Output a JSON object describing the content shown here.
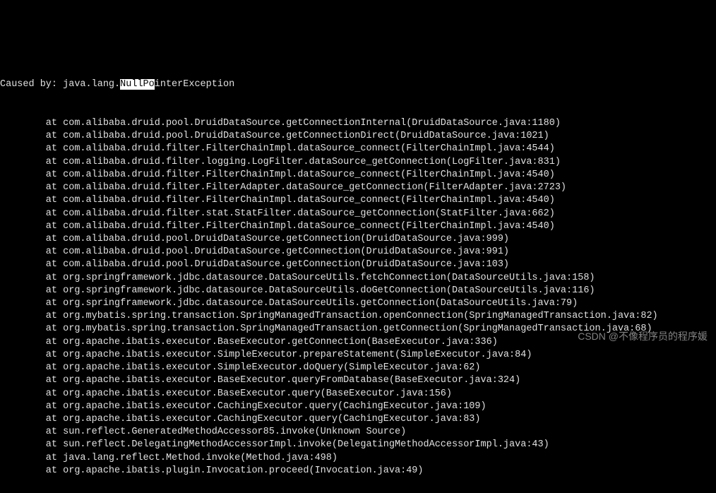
{
  "exception": {
    "prefix": "Caused by: java.lang.",
    "highlighted": "NullPo",
    "suffix": "interException"
  },
  "stack": [
    "        at com.alibaba.druid.pool.DruidDataSource.getConnectionInternal(DruidDataSource.java:1180)",
    "        at com.alibaba.druid.pool.DruidDataSource.getConnectionDirect(DruidDataSource.java:1021)",
    "        at com.alibaba.druid.filter.FilterChainImpl.dataSource_connect(FilterChainImpl.java:4544)",
    "        at com.alibaba.druid.filter.logging.LogFilter.dataSource_getConnection(LogFilter.java:831)",
    "        at com.alibaba.druid.filter.FilterChainImpl.dataSource_connect(FilterChainImpl.java:4540)",
    "        at com.alibaba.druid.filter.FilterAdapter.dataSource_getConnection(FilterAdapter.java:2723)",
    "        at com.alibaba.druid.filter.FilterChainImpl.dataSource_connect(FilterChainImpl.java:4540)",
    "        at com.alibaba.druid.filter.stat.StatFilter.dataSource_getConnection(StatFilter.java:662)",
    "        at com.alibaba.druid.filter.FilterChainImpl.dataSource_connect(FilterChainImpl.java:4540)",
    "        at com.alibaba.druid.pool.DruidDataSource.getConnection(DruidDataSource.java:999)",
    "        at com.alibaba.druid.pool.DruidDataSource.getConnection(DruidDataSource.java:991)",
    "        at com.alibaba.druid.pool.DruidDataSource.getConnection(DruidDataSource.java:103)",
    "        at org.springframework.jdbc.datasource.DataSourceUtils.fetchConnection(DataSourceUtils.java:158)",
    "        at org.springframework.jdbc.datasource.DataSourceUtils.doGetConnection(DataSourceUtils.java:116)",
    "        at org.springframework.jdbc.datasource.DataSourceUtils.getConnection(DataSourceUtils.java:79)",
    "        at org.mybatis.spring.transaction.SpringManagedTransaction.openConnection(SpringManagedTransaction.java:82)",
    "        at org.mybatis.spring.transaction.SpringManagedTransaction.getConnection(SpringManagedTransaction.java:68)",
    "        at org.apache.ibatis.executor.BaseExecutor.getConnection(BaseExecutor.java:336)",
    "        at org.apache.ibatis.executor.SimpleExecutor.prepareStatement(SimpleExecutor.java:84)",
    "        at org.apache.ibatis.executor.SimpleExecutor.doQuery(SimpleExecutor.java:62)",
    "        at org.apache.ibatis.executor.BaseExecutor.queryFromDatabase(BaseExecutor.java:324)",
    "        at org.apache.ibatis.executor.BaseExecutor.query(BaseExecutor.java:156)",
    "        at org.apache.ibatis.executor.CachingExecutor.query(CachingExecutor.java:109)",
    "        at org.apache.ibatis.executor.CachingExecutor.query(CachingExecutor.java:83)",
    "        at sun.reflect.GeneratedMethodAccessor85.invoke(Unknown Source)",
    "        at sun.reflect.DelegatingMethodAccessorImpl.invoke(DelegatingMethodAccessorImpl.java:43)",
    "        at java.lang.reflect.Method.invoke(Method.java:498)",
    "        at org.apache.ibatis.plugin.Invocation.proceed(Invocation.java:49)"
  ],
  "watermark": "CSDN @不像程序员的程序媛"
}
